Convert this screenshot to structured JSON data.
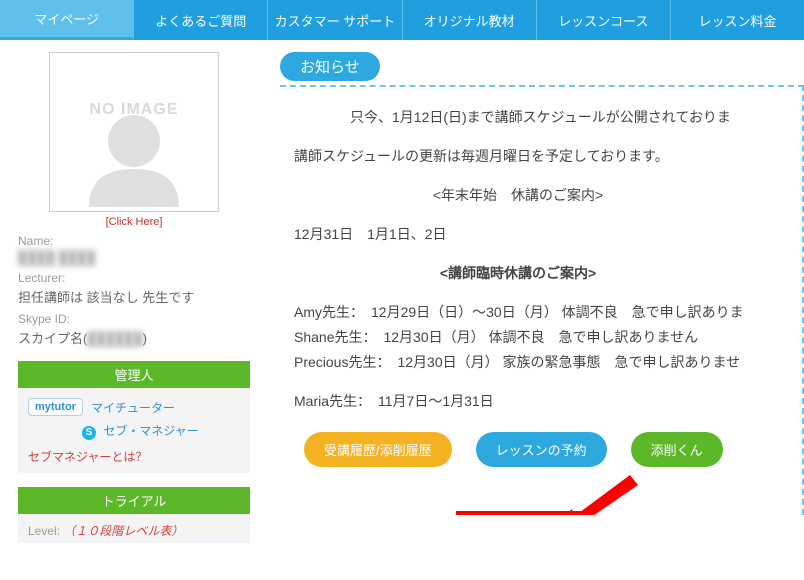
{
  "nav": {
    "tabs": [
      {
        "label": "マイページ"
      },
      {
        "label": "よくあるご質問"
      },
      {
        "label": "カスタマー サポート"
      },
      {
        "label": "オリジナル教材"
      },
      {
        "label": "レッスンコース"
      },
      {
        "label": "レッスン料金"
      }
    ]
  },
  "profile": {
    "no_image_text": "NO IMAGE",
    "click_here": "[Click Here]",
    "name_label": "Name:",
    "name_value": "████ ████",
    "lecturer_label": "Lecturer:",
    "lecturer_value": "担任講師は 該当なし 先生です",
    "skype_label": "Skype ID:",
    "skype_value_prefix": "スカイプ名(",
    "skype_value_blur": "██████",
    "skype_value_suffix": ")"
  },
  "admin_panel": {
    "header": "管理人",
    "badge": "mytutor",
    "line1": "マイチューター",
    "line2": "セブ・マネジャー",
    "line3": "セブマネジャーとは？"
  },
  "trial_panel": {
    "header": "トライアル",
    "level_label": "Level:",
    "level_link": "（１０段階レベル表）"
  },
  "notice": {
    "header": "お知らせ",
    "p1": "只今、1月12日(日)まで講師スケジュールが公開されておりま",
    "p2": "講師スケジュールの更新は毎週月曜日を予定しております。",
    "p3": "<年末年始　休講のご案内>",
    "p4": "12月31日　1月1日、2日",
    "p5": "<講師臨時休講のご案内>",
    "t1": "Amy先生：　12月29日（日）～30日（月） 体調不良　急で申し訳ありま",
    "t2": "Shane先生：　12月30日（月） 体調不良　急で申し訳ありません",
    "t3": "Precious先生：　12月30日（月） 家族の緊急事態　急で申し訳ありませ",
    "t4": "Maria先生：　11月7日～1月31日",
    "buttons": {
      "history": "受講履歴/添削履歴",
      "reserve": "レッスンの予約",
      "tensaku": "添削くん"
    }
  }
}
